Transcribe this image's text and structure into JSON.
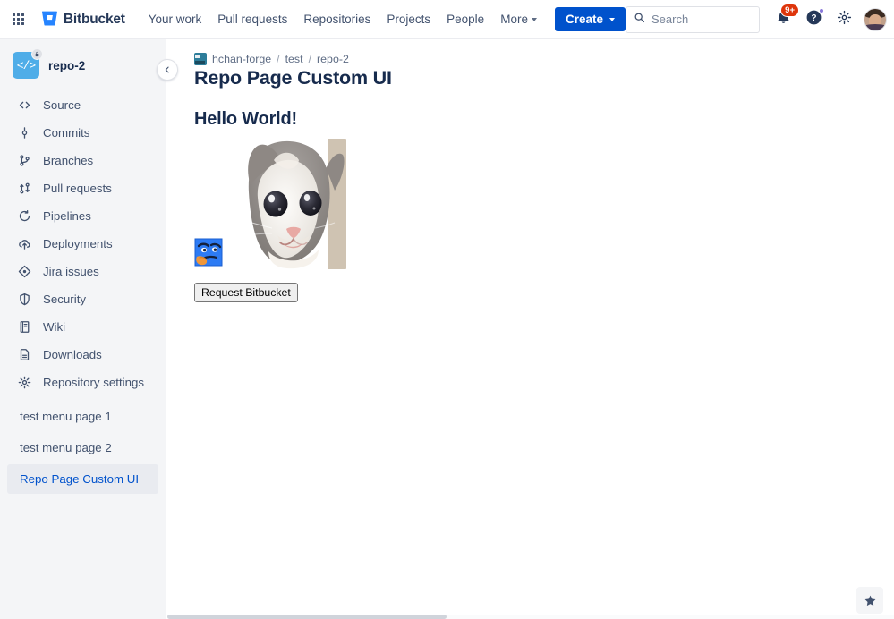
{
  "topnav": {
    "app_switcher_icon": "grid-apps-icon",
    "brand": {
      "icon": "bitbucket-logo-icon",
      "name": "Bitbucket"
    },
    "links": [
      {
        "label": "Your work",
        "has_caret": false
      },
      {
        "label": "Pull requests",
        "has_caret": false
      },
      {
        "label": "Repositories",
        "has_caret": false
      },
      {
        "label": "Projects",
        "has_caret": false
      },
      {
        "label": "People",
        "has_caret": false
      },
      {
        "label": "More",
        "has_caret": true
      }
    ],
    "create_button": {
      "label": "Create",
      "color": "#0052cc"
    },
    "search": {
      "placeholder": "Search",
      "value": "",
      "icon": "search-icon"
    },
    "notifications": {
      "icon": "notification-bell-icon",
      "badge": "9+",
      "badge_color": "#de350b"
    },
    "help": {
      "icon": "help-question-icon",
      "has_dot": true
    },
    "settings": {
      "icon": "gear-icon"
    },
    "profile": {
      "icon": "user-avatar"
    }
  },
  "sidebar": {
    "repo": {
      "name": "repo-2",
      "icon": "repository-code-icon",
      "badge_icon": "lock-icon",
      "color": "#4fade8"
    },
    "collapse_button": {
      "icon": "chevron-left-icon"
    },
    "items": [
      {
        "label": "Source",
        "icon": "source-code-icon"
      },
      {
        "label": "Commits",
        "icon": "commits-icon"
      },
      {
        "label": "Branches",
        "icon": "branches-icon"
      },
      {
        "label": "Pull requests",
        "icon": "pull-requests-icon"
      },
      {
        "label": "Pipelines",
        "icon": "pipelines-icon"
      },
      {
        "label": "Deployments",
        "icon": "deployments-cloud-icon"
      },
      {
        "label": "Jira issues",
        "icon": "jira-issues-icon"
      },
      {
        "label": "Security",
        "icon": "security-shield-icon"
      },
      {
        "label": "Wiki",
        "icon": "wiki-book-icon"
      },
      {
        "label": "Downloads",
        "icon": "downloads-file-icon"
      },
      {
        "label": "Repository settings",
        "icon": "gear-icon"
      }
    ],
    "plain_items": [
      {
        "label": "test menu page 1",
        "selected": false
      },
      {
        "label": "test menu page 2",
        "selected": false
      },
      {
        "label": "Repo Page Custom UI",
        "selected": true
      }
    ],
    "selected_color": "#0052cc",
    "selected_bg": "#e9ebf0"
  },
  "main": {
    "breadcrumb": {
      "workspace_icon": "workspace-avatar-icon",
      "items": [
        "hchan-forge",
        "test",
        "repo-2"
      ],
      "separator": "/"
    },
    "page_title": "Repo Page Custom UI",
    "heading": "Hello World!",
    "image": {
      "name": "kitten-photo",
      "alt": "white and gray kitten face"
    },
    "emoji": {
      "name": "thinking-face-icon"
    },
    "request_button": {
      "label": "Request Bitbucket"
    }
  },
  "footer": {
    "feedback_button": {
      "icon": "star-feedback-icon"
    }
  }
}
